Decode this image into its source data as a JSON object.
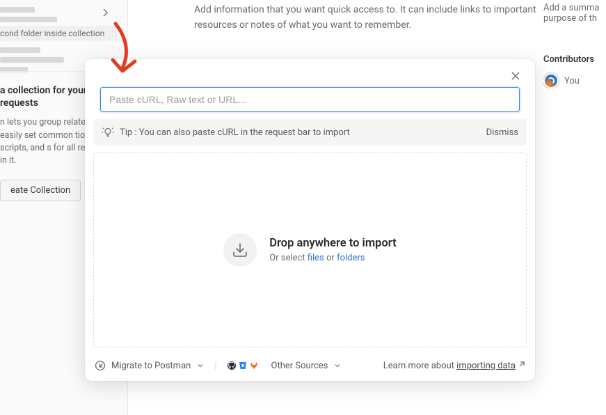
{
  "sidebar": {
    "folder_label": "cond folder inside collection",
    "promo": {
      "heading_l1": "a collection for your",
      "heading_l2": "requests",
      "body": "n lets you group related and easily set common tion, tests, scripts, and s for all requests in it.",
      "button": "eate Collection"
    }
  },
  "main": {
    "description": "Add information that you want quick access to. It can include links to important resources or notes of what you want to remember."
  },
  "contributors": {
    "summary_l1": "Add a summa",
    "summary_l2": "purpose of th",
    "heading": "Contributors",
    "you": "You"
  },
  "modal": {
    "input_placeholder": "Paste cURL, Raw text or URL...",
    "tip_text": "Tip : You can also paste cURL in the request bar to import",
    "dismiss": "Dismiss",
    "drop_title": "Drop anywhere to import",
    "drop_sub_prefix": "Or select ",
    "drop_link_files": "files",
    "drop_sub_mid": " or ",
    "drop_link_folders": "folders",
    "migrate": "Migrate to Postman",
    "other_sources": "Other Sources",
    "learn_prefix": "Learn more about ",
    "learn_link": "importing data"
  }
}
